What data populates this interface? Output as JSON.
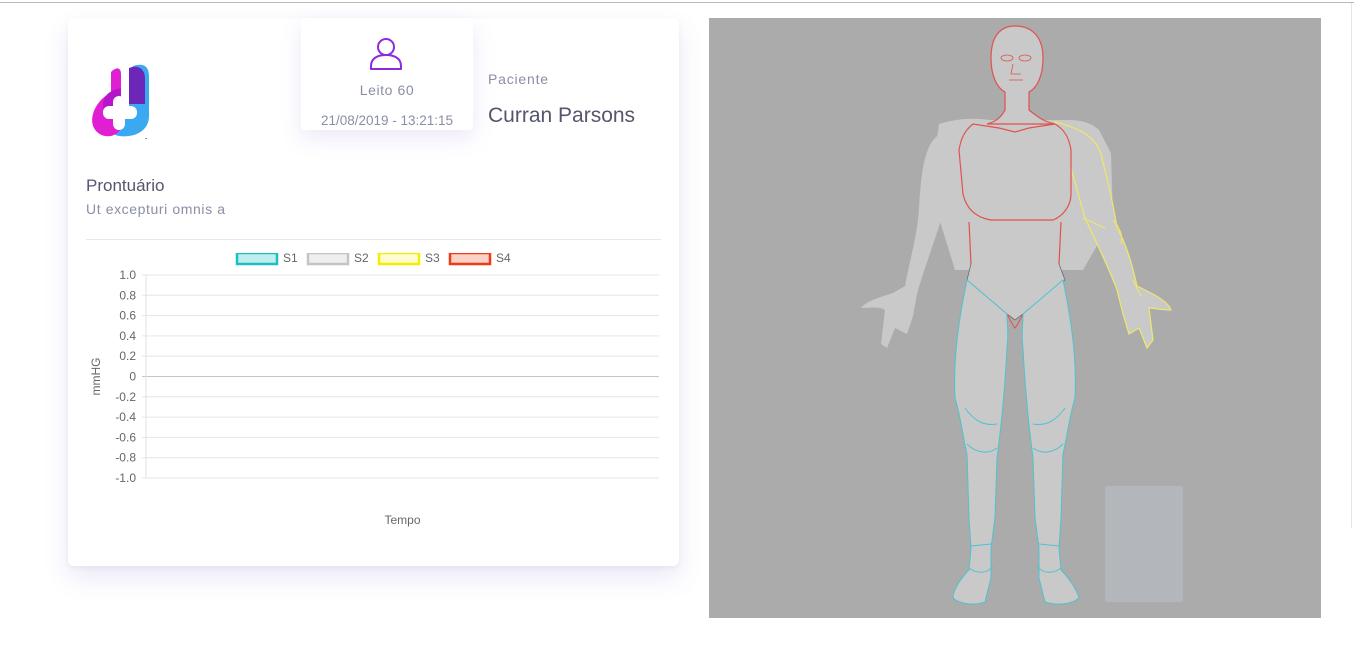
{
  "bed": {
    "label": "Leito 60",
    "timestamp": "21/08/2019 - 13:21:15"
  },
  "patient": {
    "label": "Paciente",
    "name": "Curran Parsons"
  },
  "record": {
    "title": "Prontuário",
    "subtitle": "Ut excepturi omnis a"
  },
  "icons": {
    "logo": "medical-cross-logo",
    "bed": "user-outline-icon"
  },
  "colors": {
    "accent": "#8a2be2",
    "panel_bg": "#ababab"
  },
  "chart_data": {
    "type": "line",
    "xlabel": "Tempo",
    "ylabel": "mmHG",
    "ylim": [
      -1.0,
      1.0
    ],
    "y_ticks": [
      "1.0",
      "0.8",
      "0.6",
      "0.4",
      "0.2",
      "0",
      "-0.2",
      "-0.4",
      "-0.6",
      "-0.8",
      "-1.0"
    ],
    "legend_position": "top",
    "grid": true,
    "series": [
      {
        "name": "S1",
        "color": "#1fbfbf",
        "fill": "#bfeeee",
        "values": []
      },
      {
        "name": "S2",
        "color": "#c4c4c4",
        "fill": "#eeeeee",
        "values": []
      },
      {
        "name": "S3",
        "color": "#f2ee00",
        "fill": "#fffbd0",
        "values": []
      },
      {
        "name": "S4",
        "color": "#f03a17",
        "fill": "#fbd2c8",
        "values": []
      }
    ]
  }
}
